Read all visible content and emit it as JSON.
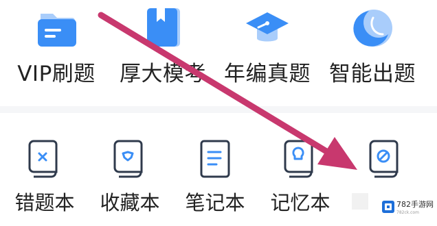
{
  "features": [
    {
      "label": "VIP刷题",
      "icon": "folder-icon"
    },
    {
      "label": "厚大模考",
      "icon": "book-icon"
    },
    {
      "label": "年编真题",
      "icon": "graduation-cap-icon"
    },
    {
      "label": "智能出题",
      "icon": "moon-icon"
    }
  ],
  "books": [
    {
      "label": "错题本",
      "icon": "wrong-book-icon"
    },
    {
      "label": "收藏本",
      "icon": "favorite-book-icon"
    },
    {
      "label": "笔记本",
      "icon": "notes-book-icon"
    },
    {
      "label": "记忆本",
      "icon": "memory-book-icon"
    },
    {
      "label": "",
      "icon": "cancel-book-icon"
    }
  ],
  "watermark": {
    "text": "782手游网",
    "url": "782ck.com"
  },
  "colors": {
    "primary_blue": "#3a8ef6",
    "light_blue": "#a9cdfb",
    "annotation_arrow": "#c8386e",
    "text": "#222222",
    "book_outline": "#2f3a4c"
  }
}
